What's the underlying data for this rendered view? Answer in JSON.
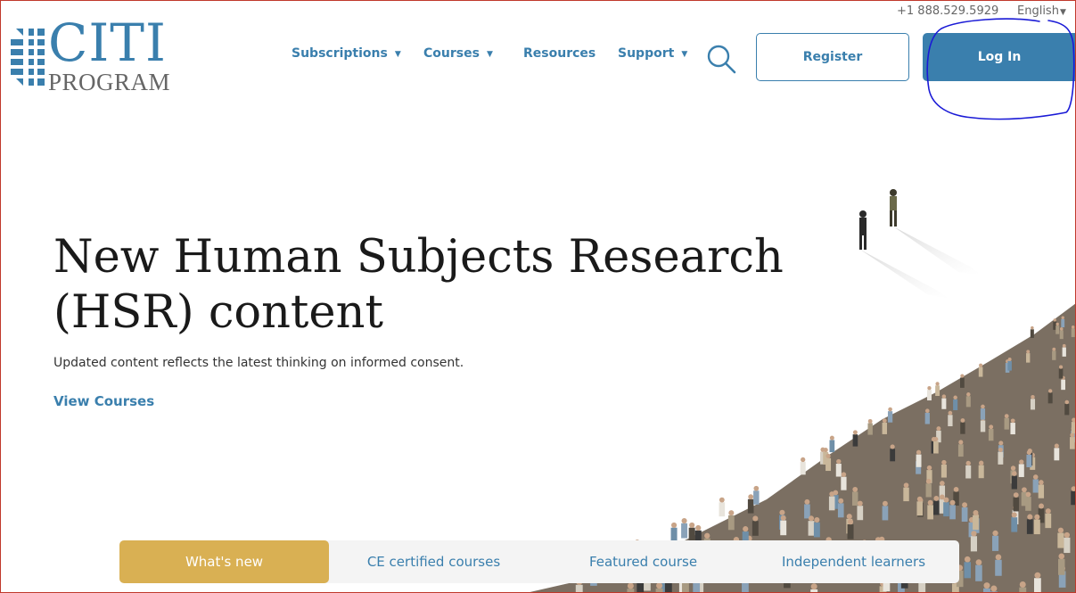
{
  "topbar": {
    "phone": "+1 888.529.5929",
    "language": "English"
  },
  "logo": {
    "line1": "CITI",
    "line2": "PROGRAM"
  },
  "nav": {
    "items": [
      {
        "label": "Subscriptions",
        "dropdown": true
      },
      {
        "label": "Courses",
        "dropdown": true
      },
      {
        "label": "Resources",
        "dropdown": false
      },
      {
        "label": "Support",
        "dropdown": true
      }
    ],
    "search_icon": "search-icon",
    "register_label": "Register",
    "login_label": "Log In"
  },
  "hero": {
    "title_line1": "New Human Subjects Research",
    "title_line2": "(HSR) content",
    "subtitle": "Updated content reflects the latest thinking on informed consent.",
    "link_label": "View Courses"
  },
  "tabs": [
    {
      "label": "What's new",
      "active": true
    },
    {
      "label": "CE certified courses",
      "active": false
    },
    {
      "label": "Featured course",
      "active": false
    },
    {
      "label": "Independent learners",
      "active": false
    }
  ],
  "colors": {
    "brand_blue": "#3a7fad",
    "accent_gold": "#d9b053",
    "annotation": "#1a1ad6"
  }
}
